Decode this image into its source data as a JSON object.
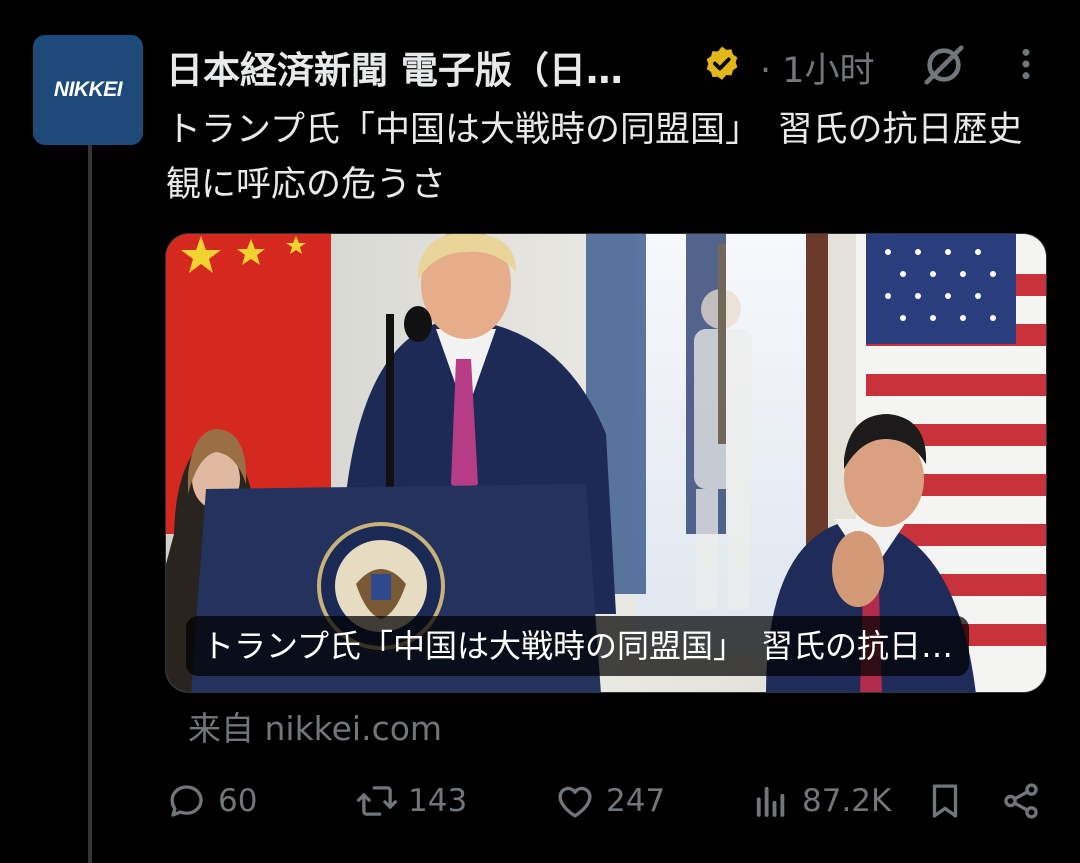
{
  "post": {
    "account": {
      "avatar_text": "NIKKEI",
      "display_name": "日本経済新聞 電子版（日…",
      "verified_badge": "verified-gold-icon",
      "time": "· 1小时"
    },
    "text": "トランプ氏「中国は大戦時の同盟国」　習氏の抗日歴史観に呼応の危うさ",
    "card": {
      "caption": "トランプ氏「中国は大戦時の同盟国」　習氏の抗日…",
      "source": "来自 nikkei.com"
    },
    "stats": {
      "replies": "60",
      "reposts": "143",
      "likes": "247",
      "views": "87.2K"
    }
  },
  "colors": {
    "background": "#000000",
    "text_primary": "#e7e9ea",
    "text_secondary": "#71767b",
    "avatar_bg": "#1d4a78",
    "verified_gold": "#e2b719",
    "divider": "#333639"
  },
  "icons": [
    "reply-icon",
    "repost-icon",
    "like-icon",
    "views-icon",
    "bookmark-icon",
    "share-icon",
    "grok-icon",
    "more-icon"
  ]
}
